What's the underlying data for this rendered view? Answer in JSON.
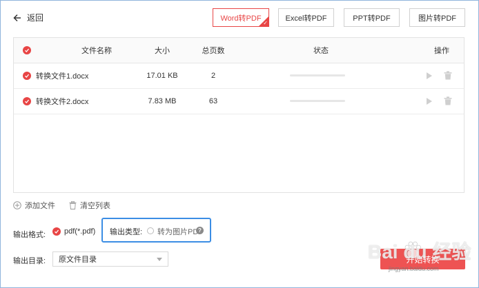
{
  "header": {
    "back_label": "返回",
    "tabs": [
      {
        "label": "Word转PDF",
        "active": true
      },
      {
        "label": "Excel转PDF",
        "active": false
      },
      {
        "label": "PPT转PDF",
        "active": false
      },
      {
        "label": "图片转PDF",
        "active": false
      }
    ]
  },
  "table": {
    "columns": [
      "文件名称",
      "大小",
      "总页数",
      "状态",
      "操作"
    ],
    "rows": [
      {
        "name": "转换文件1.docx",
        "size": "17.01 KB",
        "pages": "2",
        "progress": 0
      },
      {
        "name": "转换文件2.docx",
        "size": "7.83 MB",
        "pages": "63",
        "progress": 0
      }
    ]
  },
  "actions": {
    "add_file": "添加文件",
    "clear_list": "清空列表"
  },
  "output": {
    "format_label": "输出格式:",
    "format_value": "pdf(*.pdf)",
    "type_label": "输出类型:",
    "type_option": "转为图片PDF",
    "help_glyph": "?",
    "dir_label": "输出目录:",
    "dir_value": "原文件目录"
  },
  "convert_button": "开始转换",
  "watermark": {
    "text": "Bai du 经验",
    "sub": "jingyan.baidu.com"
  },
  "colors": {
    "accent": "#e84545",
    "highlight_border": "#3b8de4"
  }
}
